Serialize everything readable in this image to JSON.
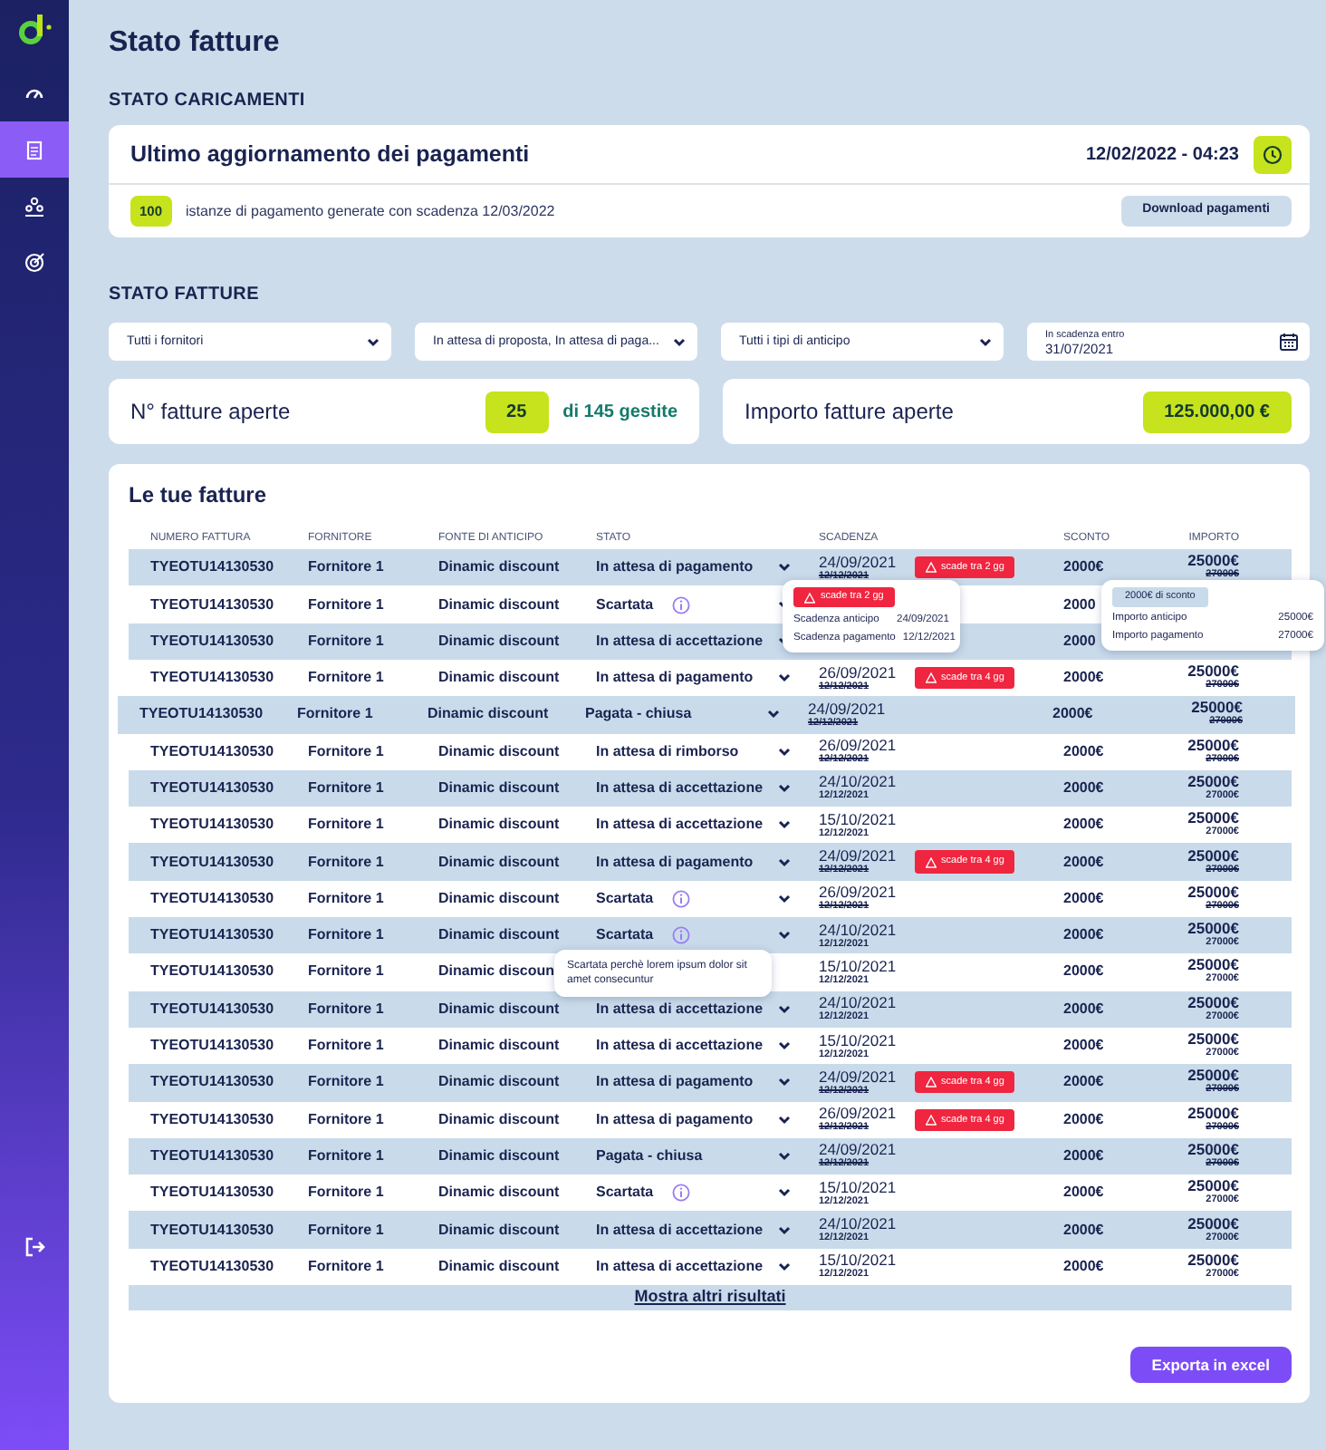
{
  "sidebar": {
    "items": [
      {
        "selected": false
      },
      {
        "selected": true
      },
      {
        "selected": false
      },
      {
        "selected": false
      }
    ]
  },
  "page_title": "Stato fatture",
  "uploads": {
    "heading": "STATO CARICAMENTI",
    "title": "Ultimo aggiornamento dei pagamenti",
    "timestamp": "12/02/2022 - 04:23",
    "count": "100",
    "description": "istanze di pagamento generate con scadenza 12/03/2022",
    "download_button": "Download pagamenti"
  },
  "invoice_status": {
    "heading": "STATO FATTURE",
    "filters": [
      {
        "kind": "select",
        "value": "Tutti i fornitori"
      },
      {
        "kind": "select",
        "value": "In attesa di proposta, In attesa di paga..."
      },
      {
        "kind": "select",
        "value": "Tutti i tipi di anticipo"
      },
      {
        "kind": "date",
        "label": "In scadenza entro",
        "value": "31/07/2021"
      }
    ],
    "open_count": {
      "label": "N° fatture aperte",
      "value": "25",
      "total": "di 145 gestite"
    },
    "open_amount": {
      "label": "Importo fatture aperte",
      "value": "125.000,00 €"
    }
  },
  "table": {
    "title": "Le tue fatture",
    "columns": [
      "NUMERO FATTURA",
      "FORNITORE",
      "FONTE DI ANTICIPO",
      "STATO",
      "SCADENZA",
      "SCONTO",
      "IMPORTO"
    ],
    "rows": [
      {
        "numero": "TYEOTU14130530",
        "fornitore": "Fornitore 1",
        "fonte": "Dinamic discount",
        "stato": "In attesa di pagamento",
        "info": false,
        "highlighted": false,
        "scadenza": "24/09/2021",
        "scadenza_originale": "12/12/2021",
        "revised": true,
        "badge": "scade tra 2 gg",
        "sconto": "2000€",
        "importo": "25000€",
        "importo_originale": "27000€"
      },
      {
        "numero": "TYEOTU14130530",
        "fornitore": "Fornitore 1",
        "fonte": "Dinamic discount",
        "stato": "Scartata",
        "info": true,
        "highlighted": false,
        "sconto": "2000"
      },
      {
        "numero": "TYEOTU14130530",
        "fornitore": "Fornitore 1",
        "fonte": "Dinamic discount",
        "stato": "In attesa di accettazione",
        "info": false,
        "highlighted": false,
        "sconto": "2000"
      },
      {
        "numero": "TYEOTU14130530",
        "fornitore": "Fornitore 1",
        "fonte": "Dinamic discount",
        "stato": "In attesa di pagamento",
        "info": false,
        "highlighted": false,
        "scadenza": "26/09/2021",
        "scadenza_originale": "12/12/2021",
        "revised": true,
        "badge": "scade tra 4 gg",
        "sconto": "2000€",
        "importo": "25000€",
        "importo_originale": "27000€"
      },
      {
        "numero": "TYEOTU14130530",
        "fornitore": "Fornitore 1",
        "fonte": "Dinamic discount",
        "stato": "Pagata - chiusa",
        "info": false,
        "highlighted": true,
        "scadenza": "24/09/2021",
        "scadenza_originale": "12/12/2021",
        "revised": true,
        "sconto": "2000€",
        "importo": "25000€",
        "importo_originale": "27000€"
      },
      {
        "numero": "TYEOTU14130530",
        "fornitore": "Fornitore 1",
        "fonte": "Dinamic discount",
        "stato": "In attesa di rimborso",
        "info": false,
        "highlighted": false,
        "scadenza": "26/09/2021",
        "scadenza_originale": "12/12/2021",
        "revised": true,
        "sconto": "2000€",
        "importo": "25000€",
        "importo_originale": "27000€"
      },
      {
        "numero": "TYEOTU14130530",
        "fornitore": "Fornitore 1",
        "fonte": "Dinamic discount",
        "stato": "In attesa di accettazione",
        "info": false,
        "highlighted": false,
        "scadenza": "24/10/2021",
        "scadenza_originale": "12/12/2021",
        "revised": false,
        "sconto": "2000€",
        "importo": "25000€",
        "importo_originale": "27000€"
      },
      {
        "numero": "TYEOTU14130530",
        "fornitore": "Fornitore 1",
        "fonte": "Dinamic discount",
        "stato": "In attesa di accettazione",
        "info": false,
        "highlighted": false,
        "scadenza": "15/10/2021",
        "scadenza_originale": "12/12/2021",
        "revised": false,
        "sconto": "2000€",
        "importo": "25000€",
        "importo_originale": "27000€"
      },
      {
        "numero": "TYEOTU14130530",
        "fornitore": "Fornitore 1",
        "fonte": "Dinamic discount",
        "stato": "In attesa di pagamento",
        "info": false,
        "highlighted": false,
        "scadenza": "24/09/2021",
        "scadenza_originale": "12/12/2021",
        "revised": true,
        "badge": "scade tra 4 gg",
        "sconto": "2000€",
        "importo": "25000€",
        "importo_originale": "27000€"
      },
      {
        "numero": "TYEOTU14130530",
        "fornitore": "Fornitore 1",
        "fonte": "Dinamic discount",
        "stato": "Scartata",
        "info": true,
        "highlighted": false,
        "scadenza": "26/09/2021",
        "scadenza_originale": "12/12/2021",
        "revised": true,
        "sconto": "2000€",
        "importo": "25000€",
        "importo_originale": "27000€"
      },
      {
        "numero": "TYEOTU14130530",
        "fornitore": "Fornitore 1",
        "fonte": "Dinamic discount",
        "stato": "Scartata",
        "info": true,
        "highlighted": false,
        "scadenza": "24/10/2021",
        "scadenza_originale": "12/12/2021",
        "revised": false,
        "sconto": "2000€",
        "importo": "25000€",
        "importo_originale": "27000€"
      },
      {
        "numero": "TYEOTU14130530",
        "fornitore": "Fornitore 1",
        "fonte": "Dinamic discoun",
        "info": false,
        "highlighted": false,
        "scadenza": "15/10/2021",
        "scadenza_originale": "12/12/2021",
        "revised": false,
        "sconto": "2000€",
        "importo": "25000€",
        "importo_originale": "27000€"
      },
      {
        "numero": "TYEOTU14130530",
        "fornitore": "Fornitore 1",
        "fonte": "Dinamic discount",
        "stato": "In attesa di accettazione",
        "info": false,
        "highlighted": false,
        "scadenza": "24/10/2021",
        "scadenza_originale": "12/12/2021",
        "revised": false,
        "sconto": "2000€",
        "importo": "25000€",
        "importo_originale": "27000€"
      },
      {
        "numero": "TYEOTU14130530",
        "fornitore": "Fornitore 1",
        "fonte": "Dinamic discount",
        "stato": "In attesa di accettazione",
        "info": false,
        "highlighted": false,
        "scadenza": "15/10/2021",
        "scadenza_originale": "12/12/2021",
        "revised": false,
        "sconto": "2000€",
        "importo": "25000€",
        "importo_originale": "27000€"
      },
      {
        "numero": "TYEOTU14130530",
        "fornitore": "Fornitore 1",
        "fonte": "Dinamic discount",
        "stato": "In attesa di pagamento",
        "info": false,
        "highlighted": false,
        "scadenza": "24/09/2021",
        "scadenza_originale": "12/12/2021",
        "revised": true,
        "badge": "scade tra 4 gg",
        "sconto": "2000€",
        "importo": "25000€",
        "importo_originale": "27000€"
      },
      {
        "numero": "TYEOTU14130530",
        "fornitore": "Fornitore 1",
        "fonte": "Dinamic discount",
        "stato": "In attesa di pagamento",
        "info": false,
        "highlighted": false,
        "scadenza": "26/09/2021",
        "scadenza_originale": "12/12/2021",
        "revised": true,
        "badge": "scade tra 4 gg",
        "sconto": "2000€",
        "importo": "25000€",
        "importo_originale": "27000€"
      },
      {
        "numero": "TYEOTU14130530",
        "fornitore": "Fornitore 1",
        "fonte": "Dinamic discount",
        "stato": "Pagata - chiusa",
        "info": false,
        "highlighted": false,
        "scadenza": "24/09/2021",
        "scadenza_originale": "12/12/2021",
        "revised": true,
        "sconto": "2000€",
        "importo": "25000€",
        "importo_originale": "27000€"
      },
      {
        "numero": "TYEOTU14130530",
        "fornitore": "Fornitore 1",
        "fonte": "Dinamic discount",
        "stato": "Scartata",
        "info": true,
        "highlighted": false,
        "scadenza": "15/10/2021",
        "scadenza_originale": "12/12/2021",
        "revised": false,
        "sconto": "2000€",
        "importo": "25000€",
        "importo_originale": "27000€"
      },
      {
        "numero": "TYEOTU14130530",
        "fornitore": "Fornitore 1",
        "fonte": "Dinamic discount",
        "stato": "In attesa di accettazione",
        "info": false,
        "highlighted": false,
        "scadenza": "24/10/2021",
        "scadenza_originale": "12/12/2021",
        "revised": false,
        "sconto": "2000€",
        "importo": "25000€",
        "importo_originale": "27000€"
      },
      {
        "numero": "TYEOTU14130530",
        "fornitore": "Fornitore 1",
        "fonte": "Dinamic discount",
        "stato": "In attesa di accettazione",
        "info": false,
        "highlighted": false,
        "scadenza": "15/10/2021",
        "scadenza_originale": "12/12/2021",
        "revised": false,
        "sconto": "2000€",
        "importo": "25000€",
        "importo_originale": "27000€"
      }
    ],
    "more_link": "Mostra altri risultati",
    "popovers": [
      {
        "kind": "deadline",
        "badge": "scade tra 2 gg",
        "rows": [
          {
            "label": "Scadenza anticipo",
            "value": "24/09/2021"
          },
          {
            "label": "Scadenza pagamento",
            "value": "12/12/2021"
          }
        ]
      },
      {
        "kind": "amount",
        "tag": "2000€ di sconto",
        "rows": [
          {
            "label": "Importo anticipo",
            "value": "25000€"
          },
          {
            "label": "Importo pagamento",
            "value": "27000€"
          }
        ]
      },
      {
        "kind": "note",
        "text": "Scartata perchè lorem ipsum dolor sit amet consecuntur"
      }
    ]
  },
  "export_button": "Exporta in excel"
}
